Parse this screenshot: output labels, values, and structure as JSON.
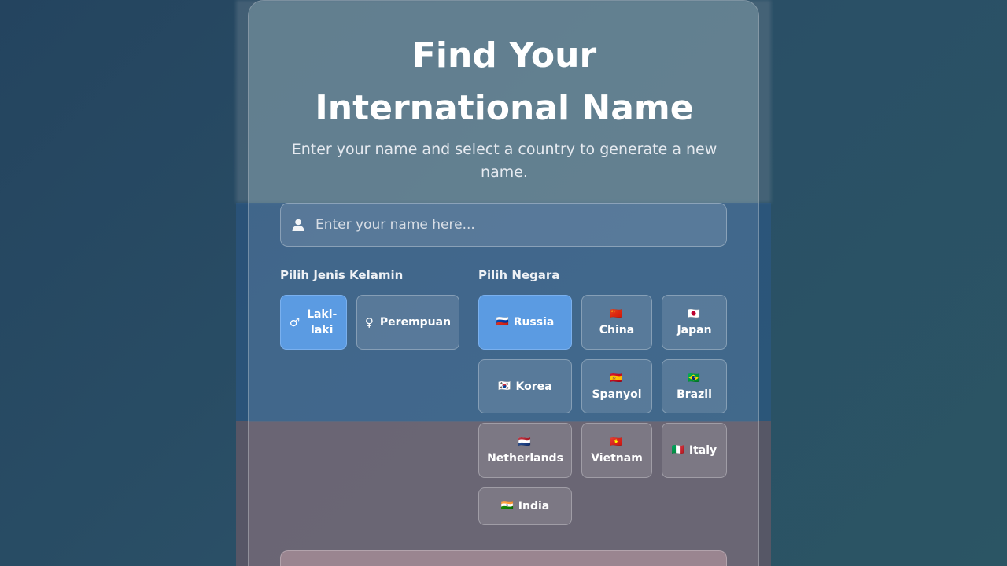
{
  "header": {
    "title": "Find Your International Name",
    "subtitle": "Enter your name and select a country to generate a new name."
  },
  "name_input": {
    "placeholder": "Enter your name here...",
    "value": "",
    "icon": "user-icon"
  },
  "gender": {
    "label": "Pilih Jenis Kelamin",
    "options": [
      {
        "label": "Laki-laki",
        "icon": "male-icon",
        "glyph": "♂",
        "selected": true
      },
      {
        "label": "Perempuan",
        "icon": "female-icon",
        "glyph": "♀",
        "selected": false
      }
    ]
  },
  "country": {
    "label": "Pilih Negara",
    "options": [
      {
        "label": "Russia",
        "flag": "🇷🇺",
        "selected": true
      },
      {
        "label": "China",
        "flag": "🇨🇳",
        "selected": false
      },
      {
        "label": "Japan",
        "flag": "🇯🇵",
        "selected": false
      },
      {
        "label": "Korea",
        "flag": "🇰🇷",
        "selected": false
      },
      {
        "label": "Spanyol",
        "flag": "🇪🇸",
        "selected": false
      },
      {
        "label": "Brazil",
        "flag": "🇧🇷",
        "selected": false
      },
      {
        "label": "Netherlands",
        "flag": "🇳🇱",
        "selected": false
      },
      {
        "label": "Vietnam",
        "flag": "🇻🇳",
        "selected": false
      },
      {
        "label": "Italy",
        "flag": "🇮🇹",
        "selected": false
      },
      {
        "label": "India",
        "flag": "🇮🇳",
        "selected": false
      }
    ]
  },
  "colors": {
    "selected": "#5b9be2",
    "text": "#ffffff"
  }
}
